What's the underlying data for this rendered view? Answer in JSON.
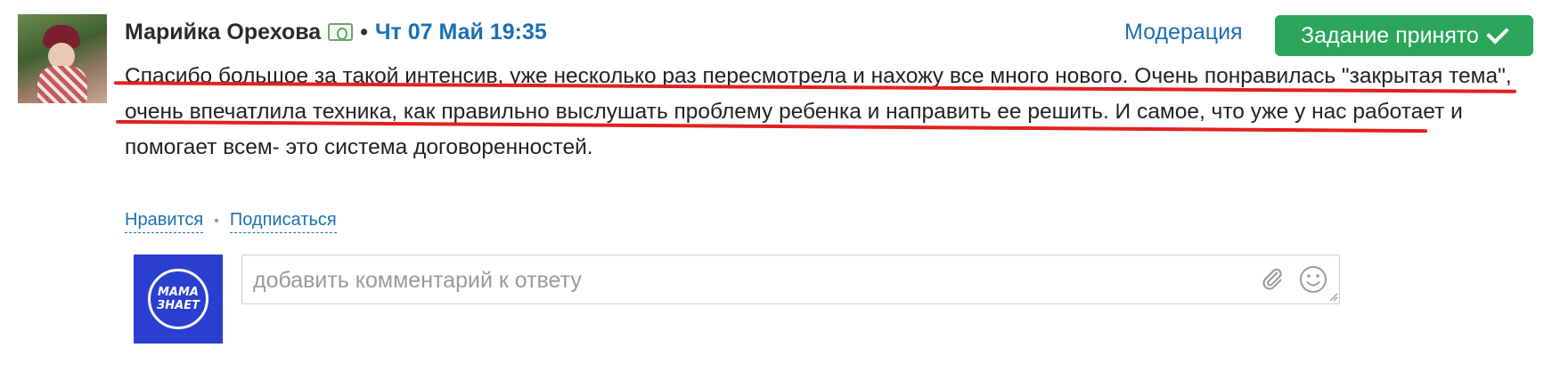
{
  "post": {
    "author": "Марийка Орехова",
    "dot": "•",
    "datetime": "Чт 07 Май 19:35",
    "answer_text": "Спасибо большое за такой интенсив, уже несколько раз пересмотрела и нахожу все много нового. Очень понравилась \"закрытая тема\", очень впечатлила техника, как правильно выслушать проблему ребенка и направить ее решить. И самое, что уже у нас работает и помогает всем- это система договоренностей."
  },
  "header_actions": {
    "moderation_label": "Модерация",
    "accepted_label": "Задание принято"
  },
  "actions": {
    "like_label": "Нравится",
    "separator": "•",
    "subscribe_label": "Подписаться"
  },
  "comment": {
    "placeholder": "добавить комментарий к ответу",
    "avatar_logo_line1": "МАМА",
    "avatar_logo_line2": "ЗНАЕТ"
  },
  "icons": {
    "author_badge": "money-icon",
    "accepted": "check-icon",
    "attach": "paperclip-icon",
    "emoji": "smiley-icon"
  },
  "colors": {
    "link": "#1b6fb3",
    "accepted_button": "#2aa55a",
    "annotation": "#e32020",
    "brand_avatar": "#2a3fd0"
  }
}
